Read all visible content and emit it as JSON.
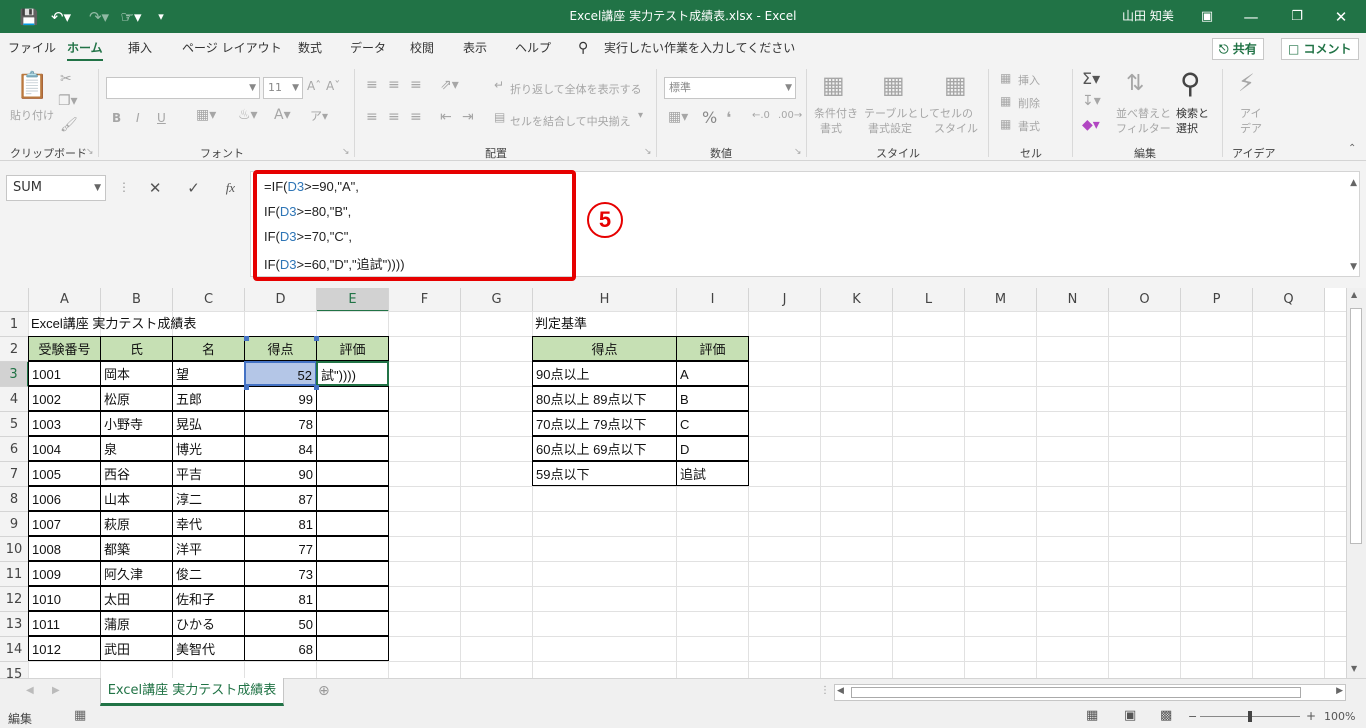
{
  "titlebar": {
    "title": "Excel講座 実力テスト成績表.xlsx  -  Excel",
    "user": "山田 知美",
    "icons": [
      "save-icon",
      "undo-icon",
      "redo-icon",
      "touch-mode-icon",
      "customize-icon",
      "ribbon-display-icon",
      "minimize-icon",
      "restore-icon",
      "close-icon"
    ]
  },
  "menu": {
    "items": [
      "ファイル",
      "ホーム",
      "挿入",
      "ページ レイアウト",
      "数式",
      "データ",
      "校閲",
      "表示",
      "ヘルプ"
    ],
    "tell_me": "実行したい作業を入力してください",
    "share": "共有",
    "comment": "コメント"
  },
  "ribbon": {
    "clipboard": {
      "label": "クリップボード",
      "paste": "貼り付け"
    },
    "font": {
      "label": "フォント",
      "size": "11",
      "bold": "B",
      "italic": "I",
      "underline": "U"
    },
    "alignment": {
      "label": "配置",
      "wrap": "折り返して全体を表示する",
      "merge": "セルを結合して中央揃え"
    },
    "number": {
      "label": "数値",
      "format": "標準",
      "percent": "%"
    },
    "styles": {
      "label": "スタイル",
      "conditional": "条件付き",
      "conditional2": "書式",
      "table": "テーブルとして",
      "table2": "書式設定",
      "cell": "セルの",
      "cell2": "スタイル"
    },
    "cells": {
      "label": "セル",
      "insert": "挿入",
      "delete": "削除",
      "format": "書式"
    },
    "editing": {
      "label": "編集",
      "sort": "並べ替えと",
      "sort2": "フィルター",
      "find": "検索と",
      "find2": "選択"
    },
    "ideas": {
      "label": "アイデア",
      "btn": "アイ",
      "btn2": "デア"
    }
  },
  "formula_bar": {
    "namebox": "SUM",
    "fx": "fx",
    "lines": [
      [
        "=IF(",
        "D3",
        ">=90,\"A\","
      ],
      [
        "IF(",
        "D3",
        ">=80,\"B\","
      ],
      [
        "IF(",
        "D3",
        ">=70,\"C\","
      ],
      [
        "IF(",
        "D3",
        ">=60,\"D\",\"追試\"))))"
      ]
    ],
    "annotation": "5"
  },
  "columns": [
    "A",
    "B",
    "C",
    "D",
    "E",
    "F",
    "G",
    "H",
    "I",
    "J",
    "K",
    "L",
    "M",
    "N",
    "O",
    "P",
    "Q"
  ],
  "rows": [
    "1",
    "2",
    "3",
    "4",
    "5",
    "6",
    "7",
    "8",
    "9",
    "10",
    "11",
    "12",
    "13",
    "14",
    "15"
  ],
  "sheet": {
    "title": "Excel講座 実力テスト成績表",
    "headers": [
      "受験番号",
      "氏",
      "名",
      "得点",
      "評価"
    ],
    "editing_text": "試\"))))",
    "data": [
      [
        "1001",
        "岡本",
        "望",
        "52"
      ],
      [
        "1002",
        "松原",
        "五郎",
        "99"
      ],
      [
        "1003",
        "小野寺",
        "晃弘",
        "78"
      ],
      [
        "1004",
        "泉",
        "博光",
        "84"
      ],
      [
        "1005",
        "西谷",
        "平吉",
        "90"
      ],
      [
        "1006",
        "山本",
        "淳二",
        "87"
      ],
      [
        "1007",
        "萩原",
        "幸代",
        "81"
      ],
      [
        "1008",
        "都築",
        "洋平",
        "77"
      ],
      [
        "1009",
        "阿久津",
        "俊二",
        "73"
      ],
      [
        "1010",
        "太田",
        "佐和子",
        "81"
      ],
      [
        "1011",
        "蒲原",
        "ひかる",
        "50"
      ],
      [
        "1012",
        "武田",
        "美智代",
        "68"
      ]
    ],
    "criteria_title": "判定基準",
    "criteria_headers": [
      "得点",
      "評価"
    ],
    "criteria": [
      [
        "90点以上",
        "A"
      ],
      [
        "80点以上 89点以下",
        "B"
      ],
      [
        "70点以上 79点以下",
        "C"
      ],
      [
        "60点以上 69点以下",
        "D"
      ],
      [
        "59点以下",
        "追試"
      ]
    ]
  },
  "tabs": {
    "sheet_name": "Excel講座 実力テスト成績表"
  },
  "status": {
    "mode": "編集",
    "zoom": "100%"
  }
}
